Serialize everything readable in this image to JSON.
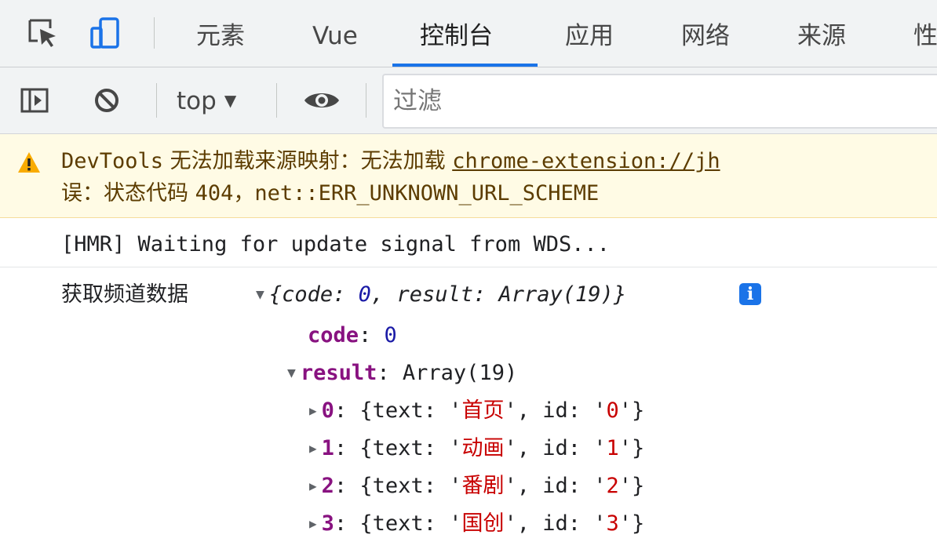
{
  "tabs": [
    "元素",
    "Vue",
    "控制台",
    "应用",
    "网络",
    "来源",
    "性"
  ],
  "active_tab": "控制台",
  "toolbar": {
    "context": "top",
    "filter_placeholder": "过滤"
  },
  "warning": {
    "prefix": "DevTools",
    "text1": " 无法加载来源映射：无法加载 ",
    "link": "chrome-extension://jh",
    "text2": "误：状态代码 ",
    "status": "404",
    "text3": "，net::ERR_UNKNOWN_URL_SCHEME"
  },
  "hmr": "[HMR] Waiting for update signal from WDS...",
  "obj": {
    "label": "获取频道数据",
    "head_code_key": "code",
    "head_code_val": "0",
    "head_result_key": "result",
    "head_result_val": "Array(19)",
    "info": "i",
    "code_key": "code",
    "code_val": "0",
    "result_key": "result",
    "result_val": "Array(19)",
    "items": [
      {
        "index": "0",
        "text": "首页",
        "id": "0"
      },
      {
        "index": "1",
        "text": "动画",
        "id": "1"
      },
      {
        "index": "2",
        "text": "番剧",
        "id": "2"
      },
      {
        "index": "3",
        "text": "国创",
        "id": "3"
      }
    ]
  },
  "colors": {
    "accent": "#1a73e8",
    "warning_bg": "#fffbe5",
    "warning_text": "#5c3c00",
    "key": "#881280",
    "string": "#c80000",
    "number": "#1a1aa6"
  },
  "icons": [
    "inspect-element-icon",
    "device-toolbar-icon",
    "sidebar-toggle-icon",
    "clear-console-icon",
    "eye-icon",
    "warning-icon",
    "info-icon"
  ]
}
